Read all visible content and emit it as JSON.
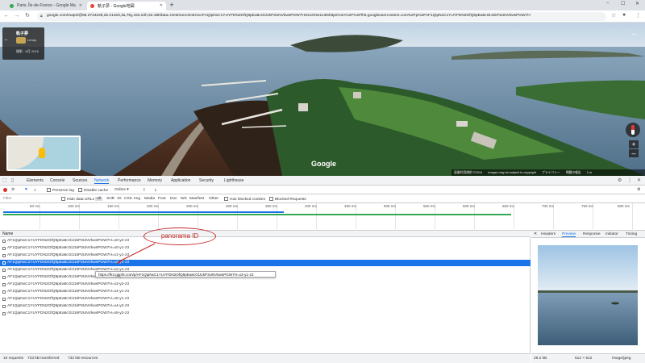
{
  "browser": {
    "tabs": [
      {
        "title": "Paris, Île-de-France - Google Ma",
        "active": false
      },
      {
        "title": "軌子夢 - Google地図",
        "active": true
      }
    ],
    "new_tab": "+",
    "window_controls": [
      "–",
      "☐",
      "✕"
    ],
    "url": "google.com/maps/@65.2724228,25.21463,3a,75y,163.22h,52.48t/data=!3m8!1e1!3m6!1sAF1QipNxC1YUYFDN2OfQ9pEa8cGlJ1kP3UNVkwsPGW7H!2e10!3e11!6shttps%3A%2F%2Flh5.googleusercontent.com%2Fp%2FAF1QipNxC1YUYFDN2OfQ9pEa8cGlJ1kP3UNVkwsPGW7H"
  },
  "streetview": {
    "place_name": "軌子夢",
    "user": "Lenap",
    "date_caption": "撮影 - 6月 2016",
    "logo": "Google",
    "footer": [
      "画像利用規約 ©2019",
      "Images may be subject to copyright",
      "プライバシー",
      "問題の報告",
      "2 m"
    ]
  },
  "devtools": {
    "tabs": [
      "Elements",
      "Console",
      "Sources",
      "Network",
      "Performance",
      "Memory",
      "Application",
      "Security",
      "Lighthouse"
    ],
    "active_tab": "Network",
    "toolbar": {
      "preserve_log": "Preserve log",
      "disable_cache": "Disable cache",
      "throttle": "Online"
    },
    "filter_bar": {
      "filter_placeholder": "Filter",
      "hide_data_urls": "Hide data URLs",
      "types": [
        "All",
        "XHR",
        "JS",
        "CSS",
        "Img",
        "Media",
        "Font",
        "Doc",
        "WS",
        "Manifest",
        "Other"
      ],
      "has_blocked_cookies": "Has blocked cookies",
      "blocked_requests": "Blocked Requests"
    },
    "timeline_ticks": [
      "50 ms",
      "100 ms",
      "150 ms",
      "200 ms",
      "250 ms",
      "300 ms",
      "350 ms",
      "400 ms",
      "450 ms",
      "500 ms",
      "550 ms",
      "600 ms",
      "650 ms",
      "700 ms",
      "750 ms",
      "800 ms"
    ],
    "column_name": "Name",
    "requests": [
      "AF1QipNxC1YUYFDN2OfQ9pEa8cGlJ1kP3UNVkwsPGW7H=x0-y2-z3",
      "AF1QipNxC1YUYFDN2OfQ9pEa8cGlJ1kP3UNVkwsPGW7H=x0-y1-z3",
      "AF1QipNxC1YUYFDN2OfQ9pEa8cGlJ1kP3UNVkwsPGW7H=x1-y1-z3",
      "AF1QipNxC1YUYFDN2OfQ9pEa8cGlJ1kP3UNVkwsPGW7H=x3-y1-z3",
      "AF1QipNxC1YUYFDN2OfQ9pEa8cGlJ1kP3UNVkwsPGW7H=x2-y1-z3",
      "AF1QipNxC1YUYFDN2OfQ9pEa8cGlJ1kP3UNVkwsPGW7H=x2-y2-z3",
      "AF1QipNxC1YUYFDN2OfQ9pEa8cGlJ1kP3UNVkwsPGW7H=x3-y2-z3",
      "AF1QipNxC1YUYFDN2OfQ9pEa8cGlJ1kP3UNVkwsPGW7H=x4-y1-z3",
      "AF1QipNxC1YUYFDN2OfQ9pEa8cGlJ1kP3UNVkwsPGW7H=x5-y1-z3",
      "AF1QipNxC1YUYFDN2OfQ9pEa8cGlJ1kP3UNVkwsPGW7H=x4-y2-z3",
      "AF1QipNxC1YUYFDN2OfQ9pEa8cGlJ1kP3UNVkwsPGW7H=x5-y2-z3"
    ],
    "selected_index": 3,
    "tooltip": "https://lh3.ggpht.com/p/AF1QipNxC1YUYFDN2OfQ9pEa8cGlJ1kP3UNVkwsPGW7H=x3-y1-z3",
    "annotation": "panorama ID",
    "status": {
      "requests": "10 requests",
      "transferred": "733 kB transferred",
      "resources": "732 kB resources"
    },
    "preview_tabs": [
      "Headers",
      "Preview",
      "Response",
      "Initiator",
      "Timing"
    ],
    "preview_active": "Preview",
    "preview_footer": {
      "size": "29.2 kB",
      "dimensions": "512 × 512",
      "mime": "image/jpeg"
    }
  }
}
